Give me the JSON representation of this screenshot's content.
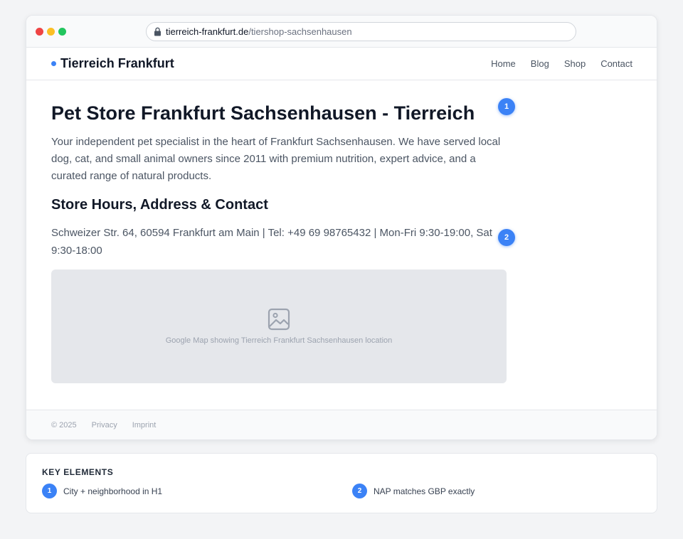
{
  "browser": {
    "url_domain": "tierreich-frankfurt.de",
    "url_path": "/tiershop-sachsenhausen"
  },
  "site": {
    "brand": "Tierreich Frankfurt",
    "nav": [
      "Home",
      "Blog",
      "Shop",
      "Contact"
    ],
    "h1": "Pet Store Frankfurt Sachsenhausen - Tierreich",
    "intro": "Your independent pet specialist in the heart of Frankfurt Sachsenhausen. We have served local dog, cat, and small animal owners since 2011 with premium nutrition, expert advice, and a curated range of natural products.",
    "h2": "Store Hours, Address & Contact",
    "nap": "Schweizer Str. 64, 60594 Frankfurt am Main | Tel: +49 69 98765432 | Mon-Fri 9:30-19:00, Sat 9:30-18:00",
    "map_caption": "Google Map showing Tierreich Frankfurt Sachsenhausen location",
    "footer": [
      "© 2025",
      "Privacy",
      "Imprint"
    ]
  },
  "markers": [
    "1",
    "2"
  ],
  "key_elements": {
    "title": "KEY ELEMENTS",
    "items": [
      {
        "num": "1",
        "text": "City + neighborhood in H1"
      },
      {
        "num": "2",
        "text": "NAP matches GBP exactly"
      }
    ]
  },
  "colors": {
    "accent": "#3b82f6",
    "traffic_red": "#ef4444",
    "traffic_yellow": "#fbbf24",
    "traffic_green": "#22c55e"
  },
  "icons": [
    "lock-icon",
    "image-icon"
  ]
}
